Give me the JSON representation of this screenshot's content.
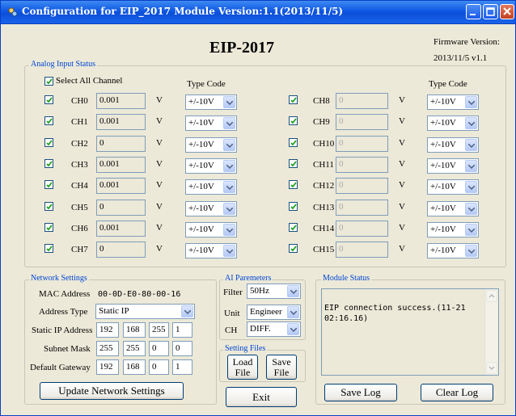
{
  "window": {
    "title": "Configuration for EIP_2017 Module Version:1.1(2013/11/5)"
  },
  "header": {
    "model": "EIP-2017",
    "firmware_label": "Firmware Version:",
    "firmware_value": "2013/11/5 v1.1"
  },
  "analog": {
    "group_label": "Analog Input Status",
    "select_all_label": "Select All Channel",
    "select_all_checked": true,
    "type_code_label": "Type Code",
    "unit": "V",
    "channels": [
      {
        "name": "CH0",
        "value": "0.001",
        "type": "+/-10V",
        "checked": true
      },
      {
        "name": "CH1",
        "value": "0.001",
        "type": "+/-10V",
        "checked": true
      },
      {
        "name": "CH2",
        "value": "0",
        "type": "+/-10V",
        "checked": true
      },
      {
        "name": "CH3",
        "value": "0.001",
        "type": "+/-10V",
        "checked": true
      },
      {
        "name": "CH4",
        "value": "0.001",
        "type": "+/-10V",
        "checked": true
      },
      {
        "name": "CH5",
        "value": "0",
        "type": "+/-10V",
        "checked": true
      },
      {
        "name": "CH6",
        "value": "0.001",
        "type": "+/-10V",
        "checked": true
      },
      {
        "name": "CH7",
        "value": "0",
        "type": "+/-10V",
        "checked": true
      },
      {
        "name": "CH8",
        "value": "0",
        "type": "+/-10V",
        "checked": true
      },
      {
        "name": "CH9",
        "value": "0",
        "type": "+/-10V",
        "checked": true
      },
      {
        "name": "CH10",
        "value": "0",
        "type": "+/-10V",
        "checked": true
      },
      {
        "name": "CH11",
        "value": "0",
        "type": "+/-10V",
        "checked": true
      },
      {
        "name": "CH12",
        "value": "0",
        "type": "+/-10V",
        "checked": true
      },
      {
        "name": "CH13",
        "value": "0",
        "type": "+/-10V",
        "checked": true
      },
      {
        "name": "CH14",
        "value": "0",
        "type": "+/-10V",
        "checked": true
      },
      {
        "name": "CH15",
        "value": "0",
        "type": "+/-10V",
        "checked": true
      }
    ]
  },
  "network": {
    "group_label": "Network Settings",
    "mac_label": "MAC Address",
    "mac_value": "00-0D-E0-80-00-16",
    "addr_type_label": "Address Type",
    "addr_type_value": "Static IP",
    "static_ip_label": "Static IP Address",
    "static_ip": [
      "192",
      "168",
      "255",
      "1"
    ],
    "subnet_label": "Subnet Mask",
    "subnet": [
      "255",
      "255",
      "0",
      "0"
    ],
    "gateway_label": "Default Gateway",
    "gateway": [
      "192",
      "168",
      "0",
      "1"
    ],
    "update_button": "Update Network Settings"
  },
  "ai_params": {
    "group_label": "AI Paremeters",
    "filter_label": "Filter",
    "filter_value": "50Hz",
    "unit_label": "Unit",
    "unit_value": "Engineer",
    "ch_label": "CH",
    "ch_value": "DIFF."
  },
  "setting_files": {
    "group_label": "Setting Files",
    "load_line1": "Load",
    "load_line2": "File",
    "save_line1": "Save",
    "save_line2": "File"
  },
  "exit_button": "Exit",
  "module_status": {
    "group_label": "Module Status",
    "message_line1": "EIP connection success.(11-21",
    "message_line2": "02:16.16)",
    "save_log_button": "Save Log",
    "clear_log_button": "Clear Log"
  },
  "colors": {
    "titlebar": "#0a4fd8",
    "group_label": "#0046d5",
    "window_bg": "#ece9d8"
  }
}
